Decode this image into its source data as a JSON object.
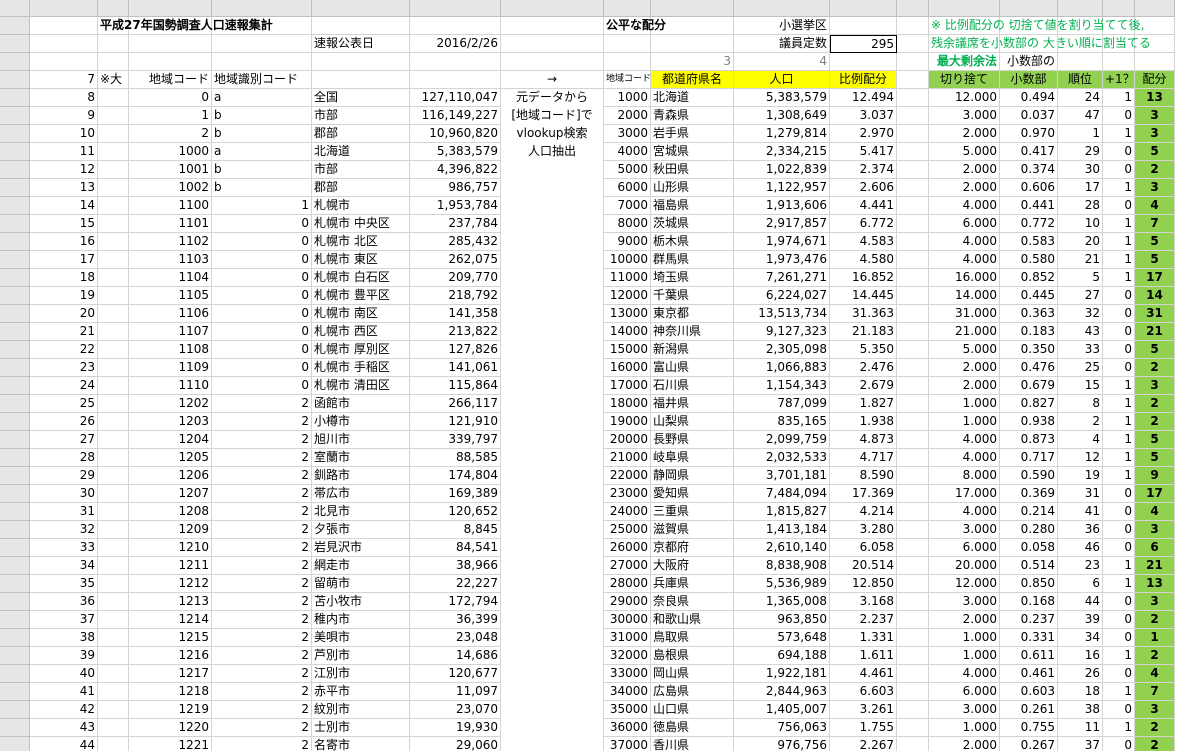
{
  "sheet": {
    "columns": [
      "A",
      "B",
      "C",
      "D",
      "E",
      "F",
      "G",
      "H",
      "I",
      "J",
      "K",
      "L",
      "M",
      "N",
      "O",
      "P",
      "Q"
    ],
    "rows": [
      {
        "n": "1",
        "A": "",
        "B": "平成27年国勢調査人口速報集計",
        "C": "",
        "D": "",
        "E": "",
        "F": "",
        "G": "",
        "H": "公平な配分",
        "I": "",
        "J": "小選挙区",
        "K": "",
        "L": "",
        "M": "※ 比例配分の 切捨て値を割り当てて後,",
        "N": "",
        "O": "",
        "P": "",
        "Q": ""
      },
      {
        "n": "2",
        "A": "",
        "B": "",
        "C": "",
        "D": "",
        "E": "速報公表日",
        "F": "2016/2/26",
        "G": "",
        "H": "",
        "I": "",
        "J": "議員定数",
        "K": "295",
        "L": "",
        "M": "残余議席を小数部の 大きい順に割当てる",
        "N": "",
        "O": "",
        "P": "",
        "Q": ""
      },
      {
        "n": "3",
        "A": "",
        "B": "",
        "C": "",
        "D": "",
        "E": "",
        "F": "",
        "G": "",
        "H": "",
        "I": "3",
        "J": "4",
        "K": "",
        "L": "",
        "M": "最大剰余法",
        "N": "小数部の",
        "O": "",
        "P": "",
        "Q": ""
      },
      {
        "n": "4",
        "A": "7",
        "B": "※大",
        "C": "地域コード",
        "D": "地域識別コード",
        "E": "",
        "F": "",
        "G": "→",
        "H": "地域コード",
        "I": "都道府県名",
        "J": "人口",
        "K": "比例配分",
        "L": "",
        "M": "切り捨て",
        "N": "小数部",
        "O": "順位",
        "P": "+1？",
        "Q": "配分"
      },
      {
        "n": "5",
        "A": "8",
        "B": "",
        "C": "0",
        "D": "a",
        "E": "全国",
        "F": "127,110,047",
        "G": "元データから",
        "H": "1000",
        "I": "北海道",
        "J": "5,383,579",
        "K": "12.494",
        "L": "",
        "M": "12.000",
        "N": "0.494",
        "O": "24",
        "P": "1",
        "Q": "13"
      },
      {
        "n": "6",
        "A": "9",
        "B": "",
        "C": "1",
        "D": "b",
        "E": "市部",
        "F": "116,149,227",
        "G": "[地域コード]で",
        "H": "2000",
        "I": "青森県",
        "J": "1,308,649",
        "K": "3.037",
        "L": "",
        "M": "3.000",
        "N": "0.037",
        "O": "47",
        "P": "0",
        "Q": "3"
      },
      {
        "n": "7",
        "A": "10",
        "B": "",
        "C": "2",
        "D": "b",
        "E": "郡部",
        "F": "10,960,820",
        "G": "vlookup検索",
        "H": "3000",
        "I": "岩手県",
        "J": "1,279,814",
        "K": "2.970",
        "L": "",
        "M": "2.000",
        "N": "0.970",
        "O": "1",
        "P": "1",
        "Q": "3"
      },
      {
        "n": "8",
        "A": "11",
        "B": "",
        "C": "1000",
        "D": "a",
        "E": "北海道",
        "F": "5,383,579",
        "G": "人口抽出",
        "H": "4000",
        "I": "宮城県",
        "J": "2,334,215",
        "K": "5.417",
        "L": "",
        "M": "5.000",
        "N": "0.417",
        "O": "29",
        "P": "0",
        "Q": "5"
      },
      {
        "n": "9",
        "A": "12",
        "B": "",
        "C": "1001",
        "D": "b",
        "E": "市部",
        "F": "4,396,822",
        "G": "",
        "H": "5000",
        "I": "秋田県",
        "J": "1,022,839",
        "K": "2.374",
        "L": "",
        "M": "2.000",
        "N": "0.374",
        "O": "30",
        "P": "0",
        "Q": "2"
      },
      {
        "n": "10",
        "A": "13",
        "B": "",
        "C": "1002",
        "D": "b",
        "E": "郡部",
        "F": "986,757",
        "G": "",
        "H": "6000",
        "I": "山形県",
        "J": "1,122,957",
        "K": "2.606",
        "L": "",
        "M": "2.000",
        "N": "0.606",
        "O": "17",
        "P": "1",
        "Q": "3"
      },
      {
        "n": "11",
        "A": "14",
        "B": "",
        "C": "1100",
        "D": "1",
        "E": "札幌市",
        "F": "1,953,784",
        "G": "",
        "H": "7000",
        "I": "福島県",
        "J": "1,913,606",
        "K": "4.441",
        "L": "",
        "M": "4.000",
        "N": "0.441",
        "O": "28",
        "P": "0",
        "Q": "4"
      },
      {
        "n": "12",
        "A": "15",
        "B": "",
        "C": "1101",
        "D": "0",
        "E": "札幌市 中央区",
        "F": "237,784",
        "G": "",
        "H": "8000",
        "I": "茨城県",
        "J": "2,917,857",
        "K": "6.772",
        "L": "",
        "M": "6.000",
        "N": "0.772",
        "O": "10",
        "P": "1",
        "Q": "7"
      },
      {
        "n": "13",
        "A": "16",
        "B": "",
        "C": "1102",
        "D": "0",
        "E": "札幌市 北区",
        "F": "285,432",
        "G": "",
        "H": "9000",
        "I": "栃木県",
        "J": "1,974,671",
        "K": "4.583",
        "L": "",
        "M": "4.000",
        "N": "0.583",
        "O": "20",
        "P": "1",
        "Q": "5"
      },
      {
        "n": "14",
        "A": "17",
        "B": "",
        "C": "1103",
        "D": "0",
        "E": "札幌市 東区",
        "F": "262,075",
        "G": "",
        "H": "10000",
        "I": "群馬県",
        "J": "1,973,476",
        "K": "4.580",
        "L": "",
        "M": "4.000",
        "N": "0.580",
        "O": "21",
        "P": "1",
        "Q": "5"
      },
      {
        "n": "15",
        "A": "18",
        "B": "",
        "C": "1104",
        "D": "0",
        "E": "札幌市 白石区",
        "F": "209,770",
        "G": "",
        "H": "11000",
        "I": "埼玉県",
        "J": "7,261,271",
        "K": "16.852",
        "L": "",
        "M": "16.000",
        "N": "0.852",
        "O": "5",
        "P": "1",
        "Q": "17"
      },
      {
        "n": "16",
        "A": "19",
        "B": "",
        "C": "1105",
        "D": "0",
        "E": "札幌市 豊平区",
        "F": "218,792",
        "G": "",
        "H": "12000",
        "I": "千葉県",
        "J": "6,224,027",
        "K": "14.445",
        "L": "",
        "M": "14.000",
        "N": "0.445",
        "O": "27",
        "P": "0",
        "Q": "14"
      },
      {
        "n": "17",
        "A": "20",
        "B": "",
        "C": "1106",
        "D": "0",
        "E": "札幌市 南区",
        "F": "141,358",
        "G": "",
        "H": "13000",
        "I": "東京都",
        "J": "13,513,734",
        "K": "31.363",
        "L": "",
        "M": "31.000",
        "N": "0.363",
        "O": "32",
        "P": "0",
        "Q": "31"
      },
      {
        "n": "18",
        "A": "21",
        "B": "",
        "C": "1107",
        "D": "0",
        "E": "札幌市 西区",
        "F": "213,822",
        "G": "",
        "H": "14000",
        "I": "神奈川県",
        "J": "9,127,323",
        "K": "21.183",
        "L": "",
        "M": "21.000",
        "N": "0.183",
        "O": "43",
        "P": "0",
        "Q": "21"
      },
      {
        "n": "19",
        "A": "22",
        "B": "",
        "C": "1108",
        "D": "0",
        "E": "札幌市 厚別区",
        "F": "127,826",
        "G": "",
        "H": "15000",
        "I": "新潟県",
        "J": "2,305,098",
        "K": "5.350",
        "L": "",
        "M": "5.000",
        "N": "0.350",
        "O": "33",
        "P": "0",
        "Q": "5"
      },
      {
        "n": "20",
        "A": "23",
        "B": "",
        "C": "1109",
        "D": "0",
        "E": "札幌市 手稲区",
        "F": "141,061",
        "G": "",
        "H": "16000",
        "I": "富山県",
        "J": "1,066,883",
        "K": "2.476",
        "L": "",
        "M": "2.000",
        "N": "0.476",
        "O": "25",
        "P": "0",
        "Q": "2"
      },
      {
        "n": "21",
        "A": "24",
        "B": "",
        "C": "1110",
        "D": "0",
        "E": "札幌市 清田区",
        "F": "115,864",
        "G": "",
        "H": "17000",
        "I": "石川県",
        "J": "1,154,343",
        "K": "2.679",
        "L": "",
        "M": "2.000",
        "N": "0.679",
        "O": "15",
        "P": "1",
        "Q": "3"
      },
      {
        "n": "22",
        "A": "25",
        "B": "",
        "C": "1202",
        "D": "2",
        "E": "函館市",
        "F": "266,117",
        "G": "",
        "H": "18000",
        "I": "福井県",
        "J": "787,099",
        "K": "1.827",
        "L": "",
        "M": "1.000",
        "N": "0.827",
        "O": "8",
        "P": "1",
        "Q": "2"
      },
      {
        "n": "23",
        "A": "26",
        "B": "",
        "C": "1203",
        "D": "2",
        "E": "小樽市",
        "F": "121,910",
        "G": "",
        "H": "19000",
        "I": "山梨県",
        "J": "835,165",
        "K": "1.938",
        "L": "",
        "M": "1.000",
        "N": "0.938",
        "O": "2",
        "P": "1",
        "Q": "2"
      },
      {
        "n": "24",
        "A": "27",
        "B": "",
        "C": "1204",
        "D": "2",
        "E": "旭川市",
        "F": "339,797",
        "G": "",
        "H": "20000",
        "I": "長野県",
        "J": "2,099,759",
        "K": "4.873",
        "L": "",
        "M": "4.000",
        "N": "0.873",
        "O": "4",
        "P": "1",
        "Q": "5"
      },
      {
        "n": "25",
        "A": "28",
        "B": "",
        "C": "1205",
        "D": "2",
        "E": "室蘭市",
        "F": "88,585",
        "G": "",
        "H": "21000",
        "I": "岐阜県",
        "J": "2,032,533",
        "K": "4.717",
        "L": "",
        "M": "4.000",
        "N": "0.717",
        "O": "12",
        "P": "1",
        "Q": "5"
      },
      {
        "n": "26",
        "A": "29",
        "B": "",
        "C": "1206",
        "D": "2",
        "E": "釧路市",
        "F": "174,804",
        "G": "",
        "H": "22000",
        "I": "静岡県",
        "J": "3,701,181",
        "K": "8.590",
        "L": "",
        "M": "8.000",
        "N": "0.590",
        "O": "19",
        "P": "1",
        "Q": "9"
      },
      {
        "n": "27",
        "A": "30",
        "B": "",
        "C": "1207",
        "D": "2",
        "E": "帯広市",
        "F": "169,389",
        "G": "",
        "H": "23000",
        "I": "愛知県",
        "J": "7,484,094",
        "K": "17.369",
        "L": "",
        "M": "17.000",
        "N": "0.369",
        "O": "31",
        "P": "0",
        "Q": "17"
      },
      {
        "n": "28",
        "A": "31",
        "B": "",
        "C": "1208",
        "D": "2",
        "E": "北見市",
        "F": "120,652",
        "G": "",
        "H": "24000",
        "I": "三重県",
        "J": "1,815,827",
        "K": "4.214",
        "L": "",
        "M": "4.000",
        "N": "0.214",
        "O": "41",
        "P": "0",
        "Q": "4"
      },
      {
        "n": "29",
        "A": "32",
        "B": "",
        "C": "1209",
        "D": "2",
        "E": "夕張市",
        "F": "8,845",
        "G": "",
        "H": "25000",
        "I": "滋賀県",
        "J": "1,413,184",
        "K": "3.280",
        "L": "",
        "M": "3.000",
        "N": "0.280",
        "O": "36",
        "P": "0",
        "Q": "3"
      },
      {
        "n": "30",
        "A": "33",
        "B": "",
        "C": "1210",
        "D": "2",
        "E": "岩見沢市",
        "F": "84,541",
        "G": "",
        "H": "26000",
        "I": "京都府",
        "J": "2,610,140",
        "K": "6.058",
        "L": "",
        "M": "6.000",
        "N": "0.058",
        "O": "46",
        "P": "0",
        "Q": "6"
      },
      {
        "n": "31",
        "A": "34",
        "B": "",
        "C": "1211",
        "D": "2",
        "E": "網走市",
        "F": "38,966",
        "G": "",
        "H": "27000",
        "I": "大阪府",
        "J": "8,838,908",
        "K": "20.514",
        "L": "",
        "M": "20.000",
        "N": "0.514",
        "O": "23",
        "P": "1",
        "Q": "21"
      },
      {
        "n": "32",
        "A": "35",
        "B": "",
        "C": "1212",
        "D": "2",
        "E": "留萌市",
        "F": "22,227",
        "G": "",
        "H": "28000",
        "I": "兵庫県",
        "J": "5,536,989",
        "K": "12.850",
        "L": "",
        "M": "12.000",
        "N": "0.850",
        "O": "6",
        "P": "1",
        "Q": "13"
      },
      {
        "n": "33",
        "A": "36",
        "B": "",
        "C": "1213",
        "D": "2",
        "E": "苫小牧市",
        "F": "172,794",
        "G": "",
        "H": "29000",
        "I": "奈良県",
        "J": "1,365,008",
        "K": "3.168",
        "L": "",
        "M": "3.000",
        "N": "0.168",
        "O": "44",
        "P": "0",
        "Q": "3"
      },
      {
        "n": "34",
        "A": "37",
        "B": "",
        "C": "1214",
        "D": "2",
        "E": "稚内市",
        "F": "36,399",
        "G": "",
        "H": "30000",
        "I": "和歌山県",
        "J": "963,850",
        "K": "2.237",
        "L": "",
        "M": "2.000",
        "N": "0.237",
        "O": "39",
        "P": "0",
        "Q": "2"
      },
      {
        "n": "35",
        "A": "38",
        "B": "",
        "C": "1215",
        "D": "2",
        "E": "美唄市",
        "F": "23,048",
        "G": "",
        "H": "31000",
        "I": "鳥取県",
        "J": "573,648",
        "K": "1.331",
        "L": "",
        "M": "1.000",
        "N": "0.331",
        "O": "34",
        "P": "0",
        "Q": "1"
      },
      {
        "n": "36",
        "A": "39",
        "B": "",
        "C": "1216",
        "D": "2",
        "E": "芦別市",
        "F": "14,686",
        "G": "",
        "H": "32000",
        "I": "島根県",
        "J": "694,188",
        "K": "1.611",
        "L": "",
        "M": "1.000",
        "N": "0.611",
        "O": "16",
        "P": "1",
        "Q": "2"
      },
      {
        "n": "37",
        "A": "40",
        "B": "",
        "C": "1217",
        "D": "2",
        "E": "江別市",
        "F": "120,677",
        "G": "",
        "H": "33000",
        "I": "岡山県",
        "J": "1,922,181",
        "K": "4.461",
        "L": "",
        "M": "4.000",
        "N": "0.461",
        "O": "26",
        "P": "0",
        "Q": "4"
      },
      {
        "n": "38",
        "A": "41",
        "B": "",
        "C": "1218",
        "D": "2",
        "E": "赤平市",
        "F": "11,097",
        "G": "",
        "H": "34000",
        "I": "広島県",
        "J": "2,844,963",
        "K": "6.603",
        "L": "",
        "M": "6.000",
        "N": "0.603",
        "O": "18",
        "P": "1",
        "Q": "7"
      },
      {
        "n": "39",
        "A": "42",
        "B": "",
        "C": "1219",
        "D": "2",
        "E": "紋別市",
        "F": "23,070",
        "G": "",
        "H": "35000",
        "I": "山口県",
        "J": "1,405,007",
        "K": "3.261",
        "L": "",
        "M": "3.000",
        "N": "0.261",
        "O": "38",
        "P": "0",
        "Q": "3"
      },
      {
        "n": "40",
        "A": "43",
        "B": "",
        "C": "1220",
        "D": "2",
        "E": "士別市",
        "F": "19,930",
        "G": "",
        "H": "36000",
        "I": "徳島県",
        "J": "756,063",
        "K": "1.755",
        "L": "",
        "M": "1.000",
        "N": "0.755",
        "O": "11",
        "P": "1",
        "Q": "2"
      },
      {
        "n": "41",
        "A": "44",
        "B": "",
        "C": "1221",
        "D": "2",
        "E": "名寄市",
        "F": "29,060",
        "G": "",
        "H": "37000",
        "I": "香川県",
        "J": "976,756",
        "K": "2.267",
        "L": "",
        "M": "2.000",
        "N": "0.267",
        "O": "37",
        "P": "0",
        "Q": "2"
      }
    ]
  },
  "colors": {
    "header_bg": "#e6e6e6",
    "yellow": "#ffff00",
    "green": "#92d050",
    "green_text": "#00b050",
    "grid": "#d4d4d4"
  }
}
